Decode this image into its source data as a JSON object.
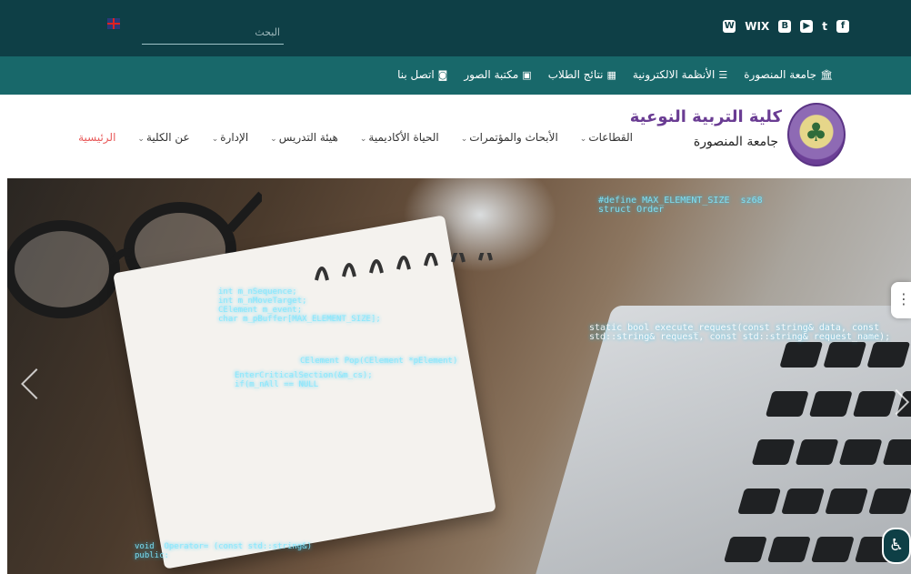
{
  "topbar": {
    "social_icons": [
      "facebook-icon",
      "twitter-icon",
      "youtube-icon",
      "blogger-icon",
      "wix-icon",
      "wordpress-icon"
    ],
    "social_glyphs": [
      "f",
      "t",
      "▶",
      "B",
      "WIX",
      "W"
    ],
    "search_placeholder": "البحث"
  },
  "links": [
    {
      "label": "جامعة المنصورة",
      "glyph": "🏛",
      "icon": "university-icon"
    },
    {
      "label": "الأنظمة الالكترونية",
      "glyph": "☰",
      "icon": "menu-icon"
    },
    {
      "label": "نتائج الطلاب",
      "glyph": "▦",
      "icon": "calendar-icon"
    },
    {
      "label": "مكتبة الصور",
      "glyph": "▣",
      "icon": "image-icon"
    },
    {
      "label": "اتصل بنا",
      "glyph": "◙",
      "icon": "contact-icon"
    }
  ],
  "header": {
    "college_name": "كلية التربية النوعية",
    "university_name": "جامعة المنصورة"
  },
  "nav": [
    {
      "label": "الرئيسية",
      "chev": "",
      "active": true
    },
    {
      "label": "عن الكلية",
      "chev": "⌄"
    },
    {
      "label": "الإدارة",
      "chev": "⌄"
    },
    {
      "label": "هيئة التدريس",
      "chev": "⌄"
    },
    {
      "label": "الحياة الأكاديمية",
      "chev": "⌄"
    },
    {
      "label": "الأبحاث والمؤتمرات",
      "chev": "⌄"
    },
    {
      "label": "القطاعات",
      "chev": "⌄"
    }
  ],
  "hero": {
    "code_lines": {
      "a": "int m_nSequence;\nint m_nMoveTarget;\nCElement m_event;\nchar m_pBuffer[MAX_ELEMENT_SIZE];",
      "b": "#define MAX_ELEMENT_SIZE  sz68\nstruct Order",
      "c": "static bool execute_request(const string& data, const\nstd::string& request, const std::string& request_name);",
      "d": "EnterCriticalSection(&m_cs);\nif(m_nAll == NULL",
      "e": "CElement Pop(CElement *pElement)",
      "f": "void  Operator= (const std::string&)\npublic:"
    }
  }
}
